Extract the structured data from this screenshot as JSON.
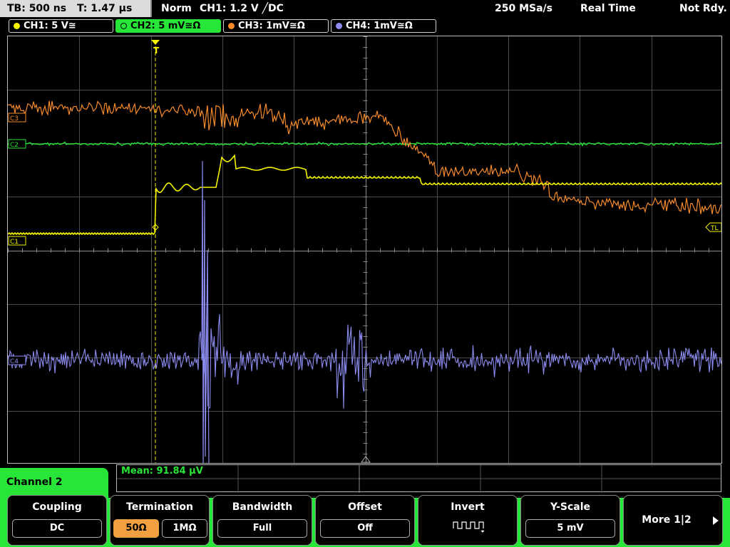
{
  "status": {
    "timebase": "TB: 500 ns",
    "trigger_time": "T: 1.47 µs",
    "trigger_mode": "Norm",
    "trigger_source": "CH1: 1.2 V ╱DC",
    "sample_rate": "250 MSa/s",
    "acq_mode": "Real Time",
    "trigger_status": "Not Rdy."
  },
  "channels": [
    {
      "label": "CH1: 5 V≅",
      "color": "#f5f500"
    },
    {
      "label": "CH2: 5 mV≅Ω",
      "color": "#27e637"
    },
    {
      "label": "CH3: 1mV≅Ω",
      "color": "#f58a2a"
    },
    {
      "label": "CH4: 1mV≅Ω",
      "color": "#8c8cf0"
    }
  ],
  "markers": {
    "ch1": "C1",
    "ch2": "C2",
    "ch3": "C3",
    "ch4": "C4",
    "trigger_level": "TL"
  },
  "measurement": {
    "text": "Mean: 91.84 µV"
  },
  "menu": {
    "title": "Channel 2",
    "coupling_label": "Coupling",
    "coupling_value": "DC",
    "termination_label": "Termination",
    "term_50": "50Ω",
    "term_1m": "1MΩ",
    "bandwidth_label": "Bandwidth",
    "bandwidth_value": "Full",
    "offset_label": "Offset",
    "offset_value": "Off",
    "invert_label": "Invert",
    "yscale_label": "Y-Scale",
    "yscale_value": "5 mV",
    "more_label": "More 1|2"
  }
}
